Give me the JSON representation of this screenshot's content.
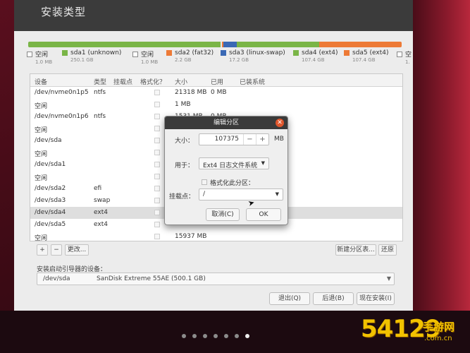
{
  "window": {
    "title": "安装类型"
  },
  "partition_bar": [
    {
      "color": "#7ab547",
      "weight": 250.1
    },
    {
      "color": "#e8e8e8",
      "weight": 1.5
    },
    {
      "color": "#ed7a36",
      "weight": 2.2
    },
    {
      "color": "#3a69b5",
      "weight": 17.2
    },
    {
      "color": "#7ab547",
      "weight": 107.4
    },
    {
      "color": "#ed7a36",
      "weight": 107.4
    }
  ],
  "legend": [
    {
      "label": "空闲",
      "size": "1.0 MB",
      "color": "",
      "kind": "empty"
    },
    {
      "label": "sda1 (unknown)",
      "size": "250.1 GB",
      "color": "#7ab547",
      "kind": "filled"
    },
    {
      "label": "空闲",
      "size": "1.0 MB",
      "color": "",
      "kind": "empty"
    },
    {
      "label": "sda2 (fat32)",
      "size": "2.2 GB",
      "color": "#ed7a36",
      "kind": "filled"
    },
    {
      "label": "sda3 (linux-swap)",
      "size": "17.2 GB",
      "color": "#3a69b5",
      "kind": "filled"
    },
    {
      "label": "sda4 (ext4)",
      "size": "107.4 GB",
      "color": "#7ab547",
      "kind": "filled"
    },
    {
      "label": "sda5 (ext4)",
      "size": "107.4 GB",
      "color": "#ed7a36",
      "kind": "filled"
    },
    {
      "label": "空",
      "size": "1.",
      "color": "",
      "kind": "empty"
    }
  ],
  "table": {
    "headers": {
      "device": "设备",
      "type": "类型",
      "mount": "挂载点",
      "format": "格式化？",
      "size": "大小",
      "used": "已用",
      "system": "已装系统"
    },
    "rows": [
      {
        "device": "/dev/nvme0n1p5",
        "type": "ntfs",
        "size": "21318 MB",
        "used": "0 MB",
        "selected": false
      },
      {
        "device": "空闲",
        "type": "",
        "size": "1 MB",
        "used": "",
        "selected": false
      },
      {
        "device": "/dev/nvme0n1p6",
        "type": "ntfs",
        "size": "1531 MB",
        "used": "0 MB",
        "selected": false
      },
      {
        "device": "空闲",
        "type": "",
        "size": "",
        "used": "",
        "selected": false
      },
      {
        "device": "/dev/sda",
        "type": "",
        "size": "",
        "used": "",
        "selected": false
      },
      {
        "device": "空闲",
        "type": "",
        "size": "",
        "used": "",
        "selected": false
      },
      {
        "device": "/dev/sda1",
        "type": "",
        "size": "",
        "used": "",
        "selected": false
      },
      {
        "device": "空闲",
        "type": "",
        "size": "",
        "used": "",
        "selected": false
      },
      {
        "device": "/dev/sda2",
        "type": "efi",
        "size": "",
        "used": "",
        "selected": false
      },
      {
        "device": "/dev/sda3",
        "type": "swap",
        "size": "",
        "used": "",
        "selected": false
      },
      {
        "device": "/dev/sda4",
        "type": "ext4",
        "size": "",
        "used": "",
        "selected": true
      },
      {
        "device": "/dev/sda5",
        "type": "ext4",
        "size": "",
        "used": "",
        "selected": false
      },
      {
        "device": "空闲",
        "type": "",
        "size": "15937 MB",
        "used": "",
        "selected": false
      }
    ]
  },
  "table_actions": {
    "add": "+",
    "remove": "−",
    "change": "更改...",
    "new_table": "新建分区表...",
    "revert": "还原"
  },
  "boot_loader": {
    "label": "安装启动引导器的设备：",
    "device": "/dev/sda",
    "description": "SanDisk Extreme 55AE (500.1 GB)"
  },
  "footer": {
    "quit": "退出(Q)",
    "back": "后退(B)",
    "install": "现在安装(I)"
  },
  "dialog": {
    "title": "编辑分区",
    "size_label": "大小：",
    "size_value": "107375",
    "size_unit": "MB",
    "use_label": "用于：",
    "use_value": "Ext4 日志文件系统",
    "format_label": "格式化此分区：",
    "mount_label": "挂载点：",
    "mount_value": "/",
    "cancel": "取消(C)",
    "ok": "OK"
  },
  "pagination": {
    "count": 7,
    "active_index": 6
  },
  "watermark": {
    "number": "54129",
    "text": "手游网",
    "url": ".com.cn"
  }
}
